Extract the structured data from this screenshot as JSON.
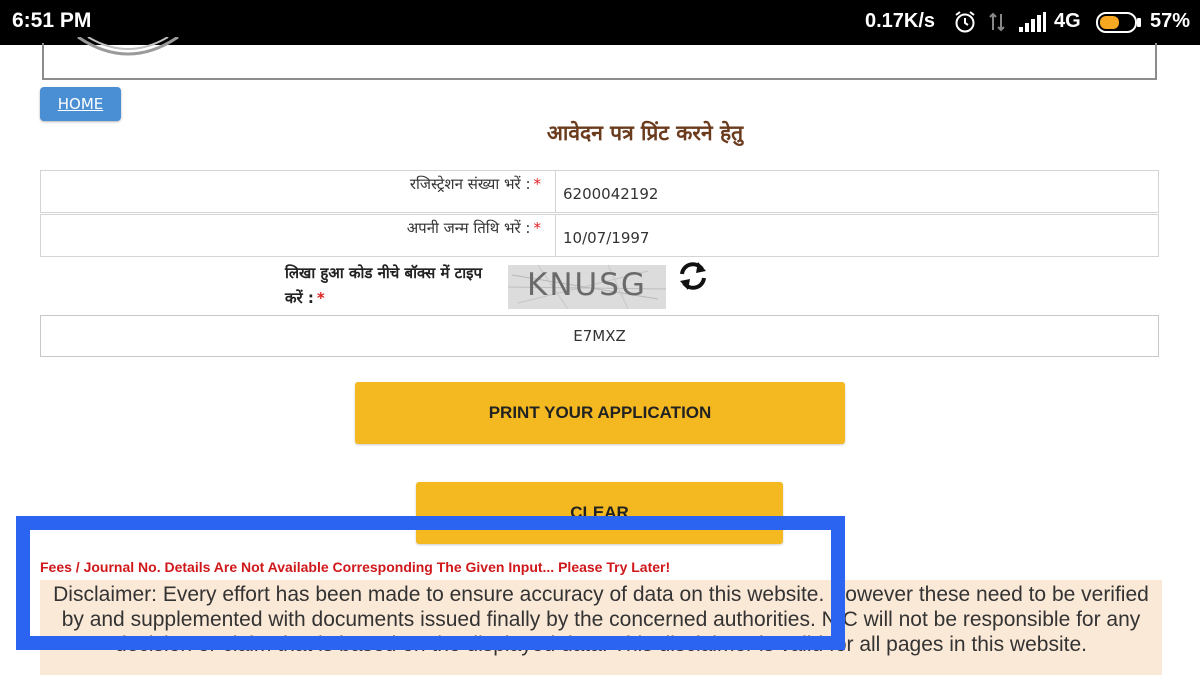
{
  "status_bar": {
    "time": "6:51 PM",
    "net_speed": "0.17K/s",
    "icons": [
      "alarm-icon",
      "data-transfer-icon",
      "signal-icon",
      "battery-icon"
    ],
    "network": "4G",
    "battery": "57%",
    "battery_level": 0.57,
    "battery_color": "#f7a823"
  },
  "nav": {
    "home_label": "HOME"
  },
  "page_title": "आवेदन पत्र प्रिंट करने हेतु",
  "form": {
    "registration": {
      "label": "रजिस्ट्रेशन संख्या भरें :",
      "required": "*",
      "value": "6200042192"
    },
    "dob": {
      "label": "अपनी जन्म तिथि भरें :",
      "required": "*",
      "value": "10/07/1997"
    },
    "captcha": {
      "label": "लिखा हुआ कोड नीचे बॉक्स में टाइप करें :",
      "required": "*",
      "image_text": "KNUSG",
      "input_value": "E7MXZ"
    }
  },
  "buttons": {
    "print": "PRINT YOUR APPLICATION",
    "clear": "CLEAR"
  },
  "error_message": "Fees / Journal No. Details Are Not Available Corresponding The Given Input... Please Try Later!",
  "disclaimer": "Disclaimer: Every effort has been made to ensure accuracy of data on this website. However these need to be verified by and supplemented with documents issued finally by the concerned authorities. NIC will not be responsible for any decision or claim that is based on the displayed data. This disclaimer is valid for all pages in this website.",
  "colors": {
    "button_yellow": "#f4b920",
    "home_blue": "#4a8fd3",
    "title_brown": "#6b3b1e",
    "error_red": "#d0181b",
    "highlight_blue": "#2b64f0"
  }
}
